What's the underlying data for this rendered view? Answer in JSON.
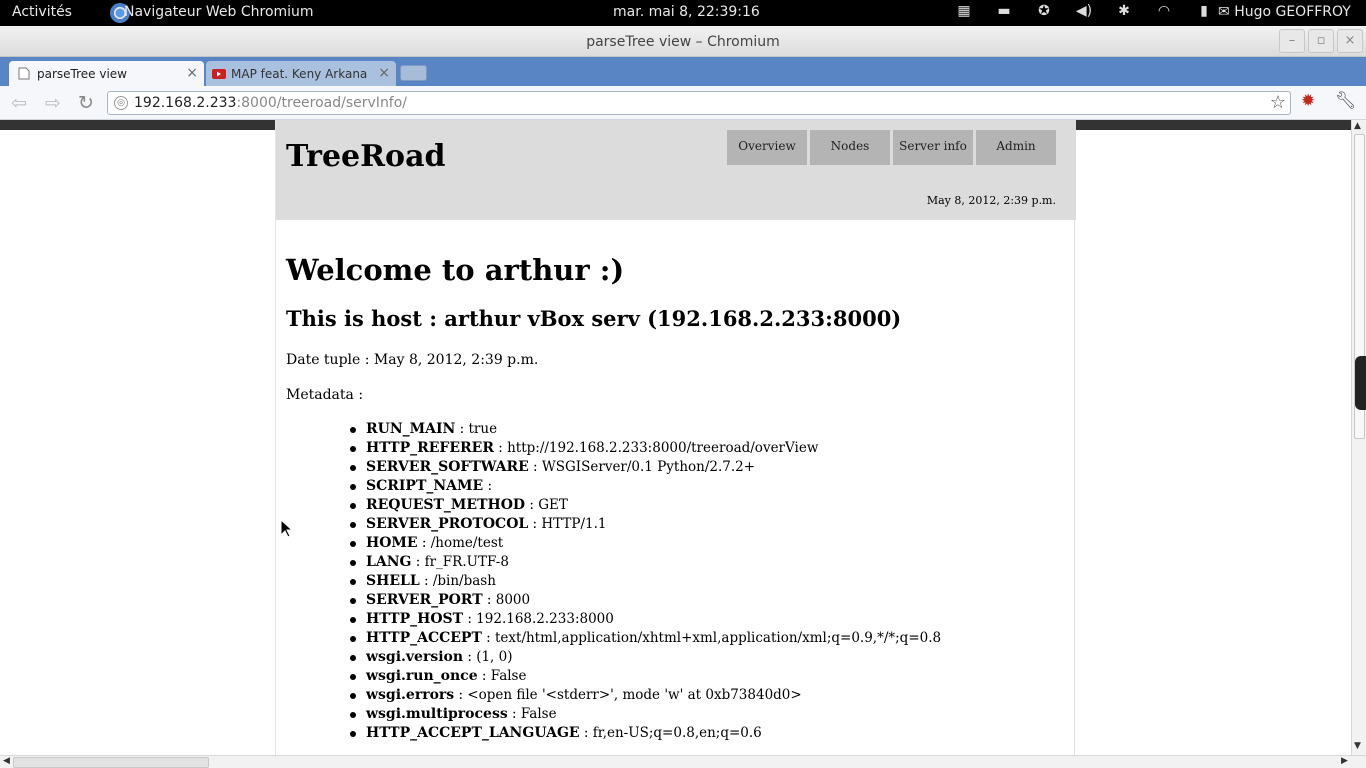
{
  "gnome_topbar": {
    "activities": "Activités",
    "app_name": "Navigateur Web Chromium",
    "clock": "mar. mai  8, 22:39:16",
    "user": "Hugo GEOFFROY"
  },
  "window": {
    "title": "parseTree view – Chromium"
  },
  "tabs": [
    {
      "label": "parseTree view",
      "active": true
    },
    {
      "label": "MAP feat. Keny Arkana - A",
      "active": false
    }
  ],
  "address_bar": {
    "host": "192.168.2.233",
    "path": ":8000/treeroad/servInfo/"
  },
  "site": {
    "logo": "TreeRoad",
    "nav": [
      "Overview",
      "Nodes",
      "Server info",
      "Admin"
    ],
    "header_date": "May 8, 2012, 2:39 p.m."
  },
  "page": {
    "welcome": "Welcome to arthur :)",
    "host_line": "This is host : arthur vBox serv (192.168.2.233:8000)",
    "date_tuple": "Date tuple : May 8, 2012, 2:39 p.m.",
    "metadata_label": "Metadata :",
    "metadata": [
      {
        "key": "RUN_MAIN",
        "value": " : true"
      },
      {
        "key": "HTTP_REFERER",
        "value": " : http://192.168.2.233:8000/treeroad/overView"
      },
      {
        "key": "SERVER_SOFTWARE",
        "value": " : WSGIServer/0.1 Python/2.7.2+"
      },
      {
        "key": "SCRIPT_NAME",
        "value": " :"
      },
      {
        "key": "REQUEST_METHOD",
        "value": " : GET"
      },
      {
        "key": "SERVER_PROTOCOL",
        "value": " : HTTP/1.1"
      },
      {
        "key": "HOME",
        "value": " : /home/test"
      },
      {
        "key": "LANG",
        "value": " : fr_FR.UTF-8"
      },
      {
        "key": "SHELL",
        "value": " : /bin/bash"
      },
      {
        "key": "SERVER_PORT",
        "value": " : 8000"
      },
      {
        "key": "HTTP_HOST",
        "value": " : 192.168.2.233:8000"
      },
      {
        "key": "HTTP_ACCEPT",
        "value": " : text/html,application/xhtml+xml,application/xml;q=0.9,*/*;q=0.8"
      },
      {
        "key": "wsgi.version",
        "value": " : (1, 0)"
      },
      {
        "key": "wsgi.run_once",
        "value": " : False"
      },
      {
        "key": "wsgi.errors",
        "value": " : <open file '<stderr>', mode 'w' at 0xb73840d0>"
      },
      {
        "key": "wsgi.multiprocess",
        "value": " : False"
      },
      {
        "key": "HTTP_ACCEPT_LANGUAGE",
        "value": " : fr,en-US;q=0.8,en;q=0.6"
      }
    ]
  },
  "icons": {
    "tray": [
      "workspace-icon",
      "files-icon",
      "accessibility-icon",
      "volume-icon",
      "bluetooth-icon",
      "wifi-icon",
      "battery-icon"
    ],
    "toolbar": [
      "back-icon",
      "forward-icon",
      "reload-icon",
      "bookmark-star-icon",
      "extension-icon",
      "wrench-icon"
    ]
  },
  "colors": {
    "tab_strip": "#5a85c5",
    "site_header": "#dcdcdc",
    "nav_item": "#b4b4b4"
  }
}
